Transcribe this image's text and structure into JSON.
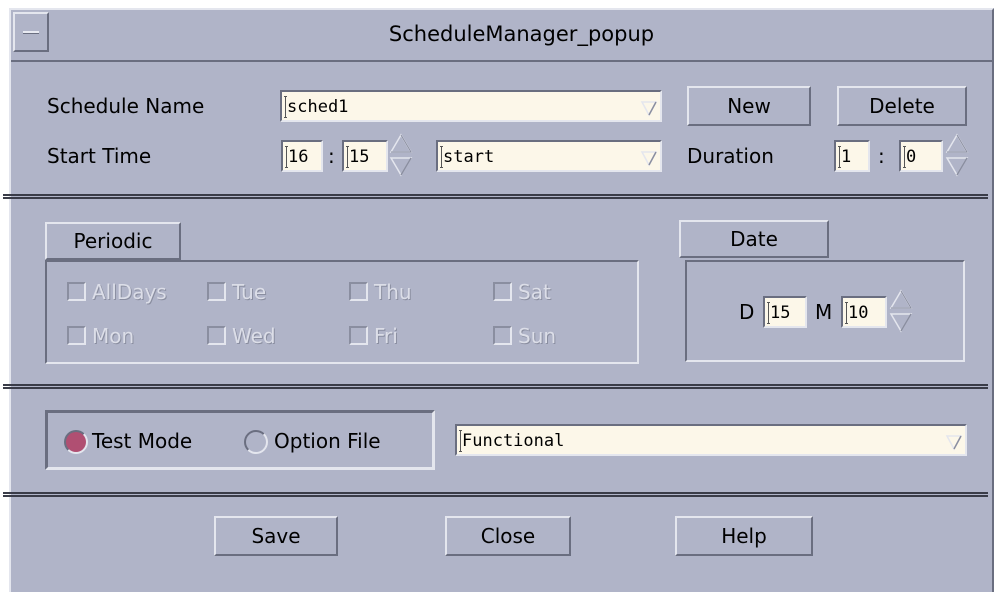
{
  "window": {
    "title": "ScheduleManager_popup"
  },
  "schedule": {
    "name_label": "Schedule Name",
    "name_value": "sched1",
    "new_label": "New",
    "delete_label": "Delete",
    "start_time_label": "Start Time",
    "start_hour": "16",
    "start_minute": "15",
    "time_colon": ":",
    "action_value": "start",
    "duration_label": "Duration",
    "duration_hours": "1",
    "duration_minutes": "0",
    "duration_colon": ":"
  },
  "periodic": {
    "tab_label": "Periodic",
    "days": [
      "AllDays",
      "Tue",
      "Thu",
      "Sat",
      "Mon",
      "Wed",
      "Fri",
      "Sun"
    ]
  },
  "date": {
    "tab_label": "Date",
    "day_label": "D",
    "day_value": "15",
    "month_label": "M",
    "month_value": "10"
  },
  "mode": {
    "test_mode_label": "Test Mode",
    "option_file_label": "Option File",
    "selected": "Test Mode",
    "mode_value": "Functional"
  },
  "footer": {
    "save_label": "Save",
    "close_label": "Close",
    "help_label": "Help"
  },
  "colors": {
    "window_bg": "#b0b4c8",
    "field_bg": "#fcf7e9",
    "radio_selected": "#b04f72"
  }
}
